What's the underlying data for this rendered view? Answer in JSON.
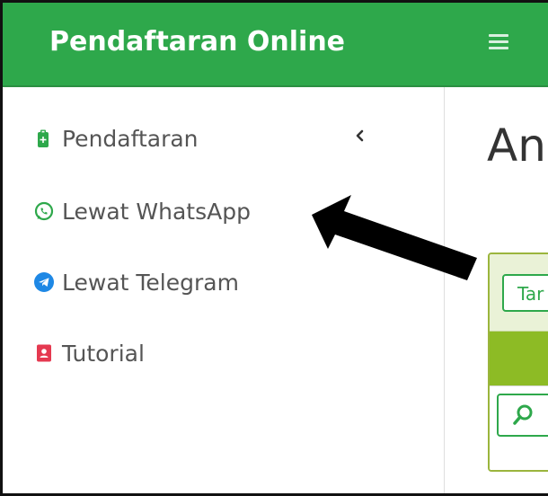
{
  "header": {
    "brand": "Pendaftaran Online",
    "menu_icon": "hamburger-menu-icon",
    "background_color": "#2ea84b"
  },
  "sidebar": {
    "items": [
      {
        "label": "Pendaftaran",
        "icon": "clipboard-icon",
        "icon_color": "#2ea84b",
        "has_submenu": true
      },
      {
        "label": "Lewat WhatsApp",
        "icon": "whatsapp-icon",
        "icon_color": "#2ea84b"
      },
      {
        "label": "Lewat Telegram",
        "icon": "telegram-icon",
        "icon_color": "#1e88e5"
      },
      {
        "label": "Tutorial",
        "icon": "contact-book-icon",
        "icon_color": "#e53950"
      }
    ],
    "submenu_indicator_icon": "chevron-left-icon"
  },
  "main": {
    "title": "An",
    "card": {
      "button_label": "Tar",
      "search_icon": "search-icon",
      "band_color": "#8dbb25"
    }
  },
  "annotation": {
    "icon": "arrow-pointer-icon",
    "color": "#000000"
  }
}
